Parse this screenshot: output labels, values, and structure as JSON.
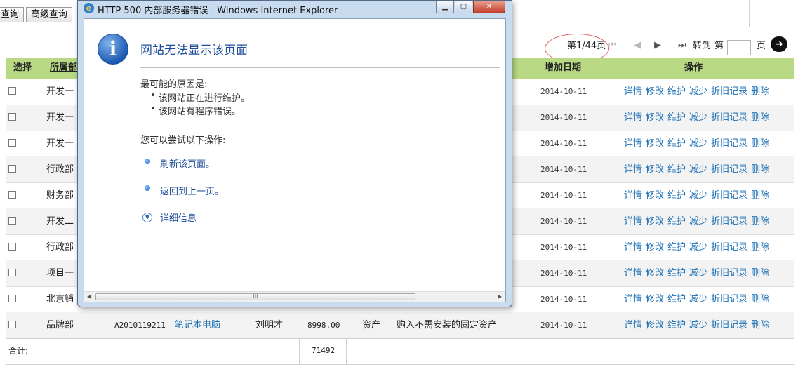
{
  "toolbar": {
    "query_label": "查询",
    "advanced_query_label": "高级查询"
  },
  "pager": {
    "page_info": "第1/44页",
    "goto_label": "转到",
    "page_prefix": "第",
    "page_suffix": "页",
    "first_icon": "first-page-icon",
    "prev_icon": "prev-page-icon",
    "next_icon": "next-page-icon",
    "last_icon": "last-page-icon"
  },
  "grid": {
    "headers": {
      "select": "选择",
      "department": "所属部",
      "add_date": "增加日期",
      "actions": "操作"
    },
    "actions": [
      "详情",
      "修改",
      "维护",
      "减少",
      "折旧记录",
      "删除"
    ],
    "rows": [
      {
        "department": "开发一",
        "date": "2014-10-11"
      },
      {
        "department": "开发一",
        "date": "2014-10-11"
      },
      {
        "department": "开发一",
        "date": "2014-10-11"
      },
      {
        "department": "行政部",
        "date": "2014-10-11"
      },
      {
        "department": "财务部",
        "date": "2014-10-11"
      },
      {
        "department": "开发二",
        "date": "2014-10-11"
      },
      {
        "department": "行政部",
        "date": "2014-10-11"
      },
      {
        "department": "项目一",
        "date": "2014-10-11"
      },
      {
        "department": "北京销",
        "date": "2014-10-11"
      }
    ],
    "last_row": {
      "department": "品牌部",
      "code": "A2010119211",
      "name": "笔记本电脑",
      "person": "刘明才",
      "price": "8998.00",
      "asset_type": "资产",
      "description": "购入不需安装的固定资产",
      "date": "2014-10-11"
    },
    "totals": {
      "label": "合计:",
      "value": "71492"
    }
  },
  "ie": {
    "title": "HTTP 500 内部服务器错误 - Windows Internet Explorer",
    "error_title": "网站无法显示该页面",
    "reasons_heading": "最可能的原因是:",
    "reasons": [
      "该网站正在进行维护。",
      "该网站有程序错误。"
    ],
    "actions_heading": "您可以尝试以下操作:",
    "actions": [
      "刷新该页面。",
      "返回到上一页。"
    ],
    "details_label": "详细信息",
    "scroll_grip": "III"
  }
}
